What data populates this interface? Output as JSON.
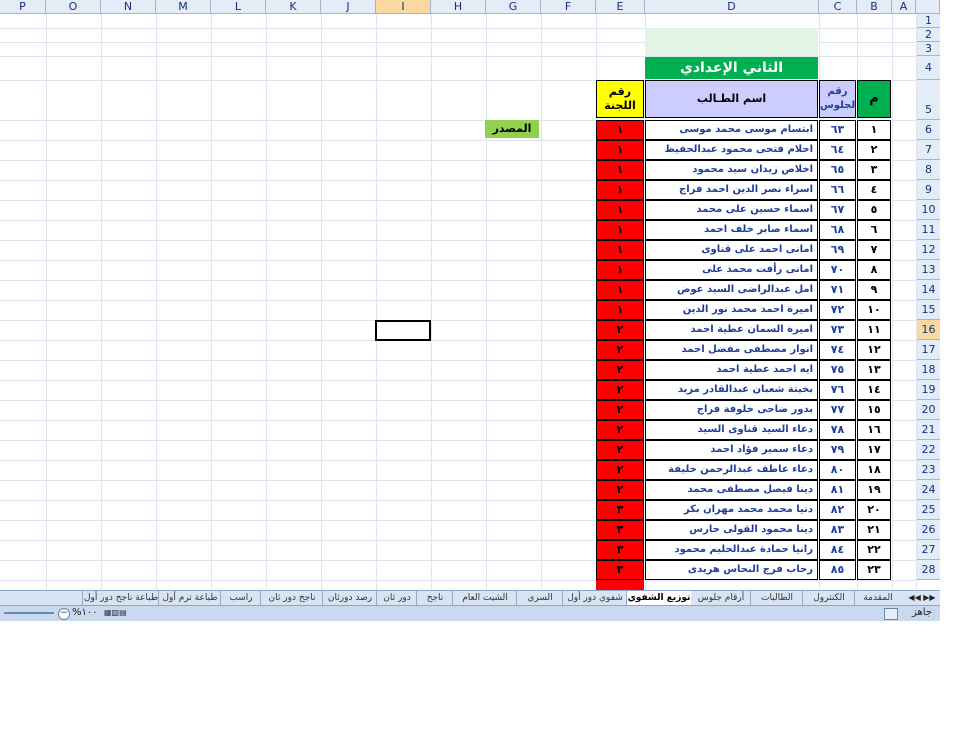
{
  "columns": [
    "P",
    "O",
    "N",
    "M",
    "L",
    "K",
    "J",
    "I",
    "H",
    "G",
    "F",
    "E",
    "D",
    "C",
    "B",
    "A"
  ],
  "row_numbers": [
    "1",
    "2",
    "3",
    "4",
    "5",
    "6",
    "7",
    "8",
    "9",
    "10",
    "11",
    "12",
    "13",
    "14",
    "15",
    "16",
    "17",
    "18",
    "19",
    "20",
    "21",
    "22",
    "23",
    "24",
    "25",
    "26",
    "27",
    "28"
  ],
  "sheet": {
    "title": "الثاني الإعدادي",
    "headers": {
      "num": "م",
      "seat": "رقم الجلوس",
      "name": "اسم الطـالب",
      "committee": "رقم اللجنة"
    },
    "source_label": "المصدر",
    "rows": [
      {
        "num": "١",
        "seat": "٦٣",
        "name": "ابتسام موسى محمد موسى",
        "committee": "١"
      },
      {
        "num": "٢",
        "seat": "٦٤",
        "name": "احلام فتحى محمود عبدالحفيظ",
        "committee": "١"
      },
      {
        "num": "٣",
        "seat": "٦٥",
        "name": "اخلاص زيدان سيد محمود",
        "committee": "١"
      },
      {
        "num": "٤",
        "seat": "٦٦",
        "name": "اسراء نصر الدين احمد فراج",
        "committee": "١"
      },
      {
        "num": "٥",
        "seat": "٦٧",
        "name": "اسماء حسين على محمد",
        "committee": "١"
      },
      {
        "num": "٦",
        "seat": "٦٨",
        "name": "اسماء صابر خلف احمد",
        "committee": "١"
      },
      {
        "num": "٧",
        "seat": "٦٩",
        "name": "امانى احمد على قناوى",
        "committee": "١"
      },
      {
        "num": "٨",
        "seat": "٧٠",
        "name": "امانى رأفت محمد على",
        "committee": "١"
      },
      {
        "num": "٩",
        "seat": "٧١",
        "name": "امل عبدالراضى السيد عوض",
        "committee": "١"
      },
      {
        "num": "١٠",
        "seat": "٧٢",
        "name": "اميرة احمد محمد نور الدين",
        "committee": "١"
      },
      {
        "num": "١١",
        "seat": "٧٣",
        "name": "اميرة السمان عطية احمد",
        "committee": "٢"
      },
      {
        "num": "١٢",
        "seat": "٧٤",
        "name": "انوار مصطفى مفضل احمد",
        "committee": "٢"
      },
      {
        "num": "١٣",
        "seat": "٧٥",
        "name": "ايه احمد عطية احمد",
        "committee": "٢"
      },
      {
        "num": "١٤",
        "seat": "٧٦",
        "name": "بخيتة شعبان عبدالقادر مزيد",
        "committee": "٢"
      },
      {
        "num": "١٥",
        "seat": "٧٧",
        "name": "بدور ضاحى خلوفة فراج",
        "committee": "٢"
      },
      {
        "num": "١٦",
        "seat": "٧٨",
        "name": "دعاء السيد قناوى السيد",
        "committee": "٢"
      },
      {
        "num": "١٧",
        "seat": "٧٩",
        "name": "دعاء سمير فؤاد احمد",
        "committee": "٢"
      },
      {
        "num": "١٨",
        "seat": "٨٠",
        "name": "دعاء عاطف عبدالرحمن خليفة",
        "committee": "٢"
      },
      {
        "num": "١٩",
        "seat": "٨١",
        "name": "دينا فيصل مصطفى محمد",
        "committee": "٢"
      },
      {
        "num": "٢٠",
        "seat": "٨٢",
        "name": "دنيا محمد محمد مهران بكر",
        "committee": "٣"
      },
      {
        "num": "٢١",
        "seat": "٨٣",
        "name": "دينا محمود القولى حارس",
        "committee": "٣"
      },
      {
        "num": "٢٢",
        "seat": "٨٤",
        "name": "رانيا حمادة عبدالحليم محمود",
        "committee": "٣"
      },
      {
        "num": "٢٣",
        "seat": "٨٥",
        "name": "رحاب فرج النحاس هريدى",
        "committee": "٣"
      }
    ]
  },
  "tabs": [
    "المقدمة",
    "الكنترول",
    "الطالبات",
    "أرقام جلوس",
    "توزيع الشفوي",
    "شفوي دور أول",
    "السري",
    "الشيت العام",
    "ناجح",
    "دور ثان",
    "رصد دورثان",
    "ناجح دور ثان",
    "راسب",
    "طباعة ترم أول",
    "طباعة ناجح دور أول"
  ],
  "status": {
    "ready": "جاهز",
    "zoom": "%١٠٠"
  },
  "colors": {
    "title_bg": "#00b050",
    "header_bg": "#ccccff",
    "committee_hdr_bg": "#ffff00",
    "committee_bg": "#ff0000",
    "source_bg": "#92d050",
    "name_color": "#1f3f9a"
  }
}
